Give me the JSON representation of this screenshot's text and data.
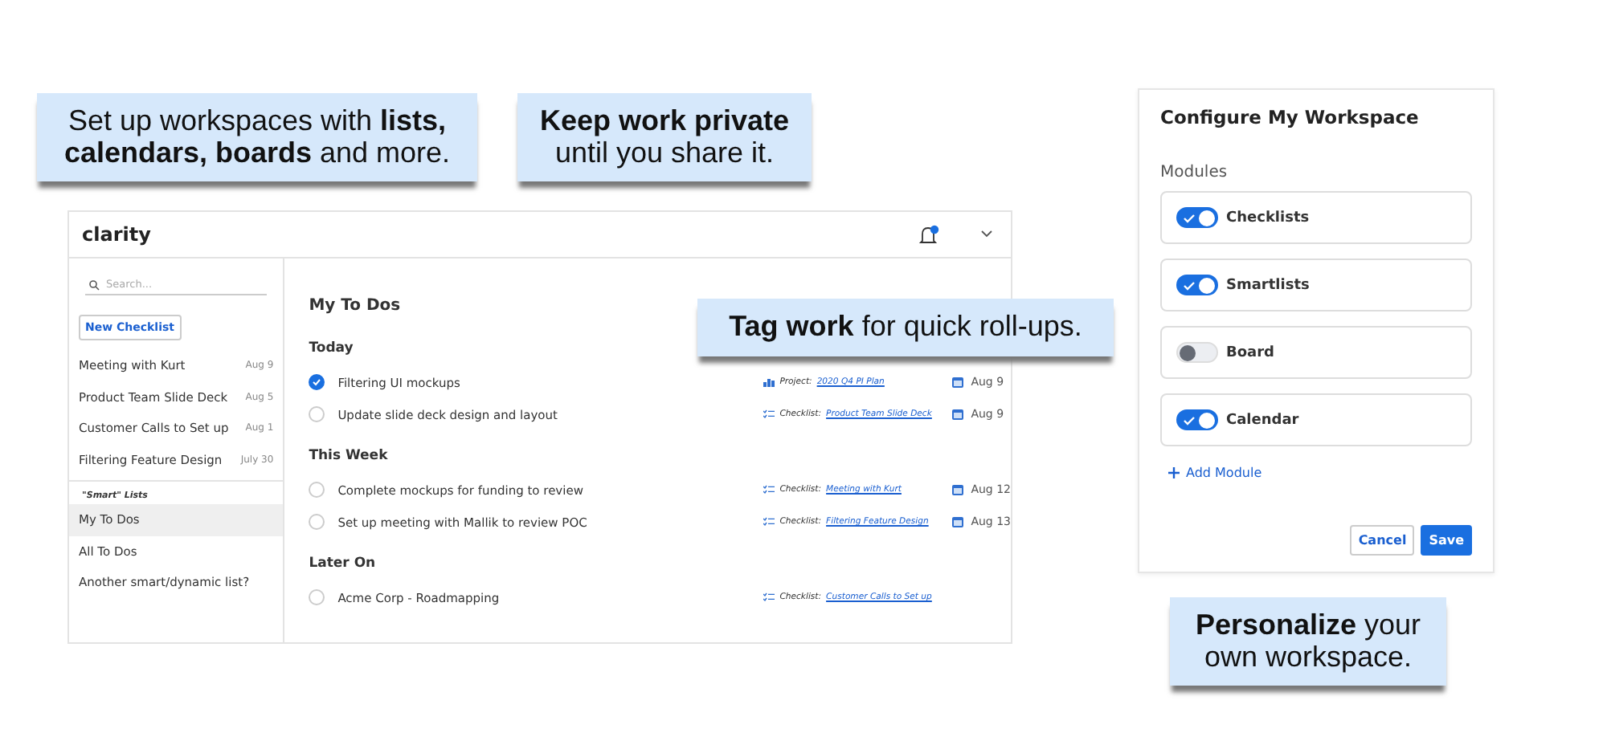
{
  "callouts": [
    {
      "lines": [
        "Set up workspaces with **lists,**",
        "**calendars, boards** and more."
      ]
    },
    {
      "lines": [
        "**Keep work private**",
        "until you share it."
      ]
    },
    {
      "lines": [
        "**Tag work** for quick roll-ups."
      ]
    },
    {
      "lines": [
        "**Personalize** your",
        "own workspace."
      ]
    }
  ],
  "app": {
    "logo": "clarity",
    "sidebar": {
      "search": {
        "placeholder": "Search..."
      },
      "new_button": "New Checklist",
      "checklists": [
        {
          "name": "Meeting with Kurt",
          "date": "Aug 9"
        },
        {
          "name": "Product Team Slide Deck",
          "date": "Aug 5"
        },
        {
          "name": "Customer Calls to Set up",
          "date": "Aug 1"
        },
        {
          "name": "Filtering Feature Design",
          "date": "July 30"
        }
      ],
      "smart_label": "\"Smart\" Lists",
      "smart_lists": [
        {
          "name": "My To Dos",
          "selected": true
        },
        {
          "name": "All To Dos",
          "selected": false
        },
        {
          "name": "Another smart/dynamic list?",
          "selected": false
        }
      ]
    },
    "main": {
      "title": "My To Dos",
      "sections": [
        {
          "title": "Today",
          "tasks": [
            {
              "text": "Filtering UI mockups",
              "done": true,
              "kind": "project",
              "tag_label": "Project:",
              "tag_link": "2020 Q4 PI Plan",
              "date": "Aug 9"
            },
            {
              "text": "Update slide deck design and layout",
              "done": false,
              "kind": "checklist",
              "tag_label": "Checklist:",
              "tag_link": "Product Team Slide Deck",
              "date": "Aug 9"
            }
          ]
        },
        {
          "title": "This Week",
          "tasks": [
            {
              "text": "Complete mockups for funding to review",
              "done": false,
              "kind": "checklist",
              "tag_label": "Checklist:",
              "tag_link": "Meeting with Kurt",
              "date": "Aug 12"
            },
            {
              "text": "Set up meeting with Mallik to review POC",
              "done": false,
              "kind": "checklist",
              "tag_label": "Checklist:",
              "tag_link": "Filtering Feature Design",
              "date": "Aug 13"
            }
          ]
        },
        {
          "title": "Later On",
          "tasks": [
            {
              "text": "Acme Corp - Roadmapping",
              "done": false,
              "kind": "checklist",
              "tag_label": "Checklist:",
              "tag_link": "Customer Calls to Set up"
            }
          ]
        }
      ]
    }
  },
  "config": {
    "title": "Configure My Workspace",
    "modules_label": "Modules",
    "modules": [
      {
        "name": "Checklists",
        "on": true
      },
      {
        "name": "Smartlists",
        "on": true
      },
      {
        "name": "Board",
        "on": false
      },
      {
        "name": "Calendar",
        "on": true
      }
    ],
    "add_module": "Add Module",
    "buttons": [
      "Cancel",
      "Save"
    ]
  }
}
